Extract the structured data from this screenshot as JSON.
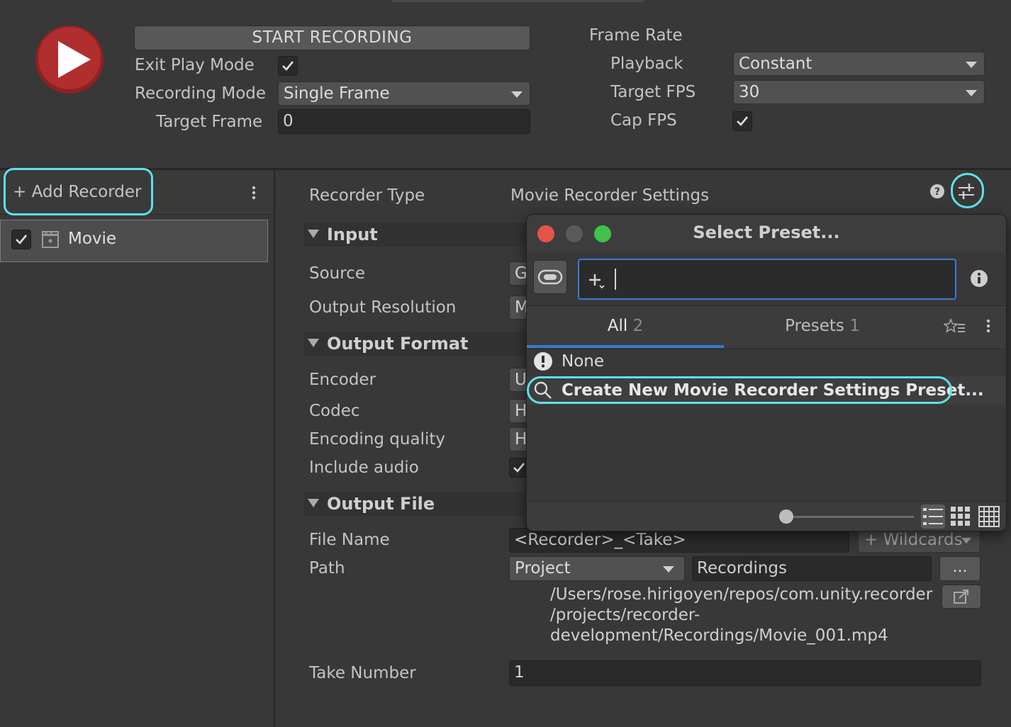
{
  "header": {
    "start_recording": "START RECORDING",
    "exit_play_mode_label": "Exit Play Mode",
    "exit_play_mode_checked": true,
    "recording_mode_label": "Recording Mode",
    "recording_mode_value": "Single Frame",
    "target_frame_label": "Target Frame",
    "target_frame_value": "0",
    "frame_rate_label": "Frame Rate",
    "playback_label": "Playback",
    "playback_value": "Constant",
    "target_fps_label": "Target FPS",
    "target_fps_value": "30",
    "cap_fps_label": "Cap FPS",
    "cap_fps_checked": true
  },
  "sidebar": {
    "add_recorder": "+ Add Recorder",
    "recorders": [
      {
        "label": "Movie",
        "enabled": true
      }
    ]
  },
  "inspector": {
    "recorder_type_label": "Recorder Type",
    "recorder_type_value": "Movie Recorder Settings",
    "input": {
      "header": "Input",
      "source_label": "Source",
      "source_value": "G",
      "output_resolution_label": "Output Resolution",
      "output_resolution_value": "M"
    },
    "output_format": {
      "header": "Output Format",
      "encoder_label": "Encoder",
      "encoder_value": "U",
      "codec_label": "Codec",
      "codec_value": "H",
      "quality_label": "Encoding quality",
      "quality_value": "H",
      "audio_label": "Include audio"
    },
    "output_file": {
      "header": "Output File",
      "file_name_label": "File Name",
      "file_name_value": "<Recorder>_<Take>",
      "wildcards": "+ Wildcards",
      "path_label": "Path",
      "path_root": "Project",
      "path_folder": "Recordings",
      "browse": "...",
      "full_path_line1": "/Users/rose.hirigoyen/repos/com.unity.recorder",
      "full_path_line2": "/projects/recorder-",
      "full_path_line3": "development/Recordings/Movie_001.mp4",
      "take_number_label": "Take Number",
      "take_number_value": "1"
    }
  },
  "preset_popup": {
    "title": "Select Preset...",
    "search_value": "",
    "tabs": [
      {
        "label": "All",
        "count": "2"
      },
      {
        "label": "Presets",
        "count": "1"
      }
    ],
    "items": [
      {
        "label": "None",
        "icon": "warning-icon"
      },
      {
        "label": "Create New Movie Recorder Settings Preset...",
        "icon": "search-icon"
      }
    ],
    "zoom_slider": 0
  },
  "colors": {
    "accent_highlight": "#5ee0ea",
    "record_button": "#b12e2e",
    "tab_underline": "#3a78c9"
  }
}
